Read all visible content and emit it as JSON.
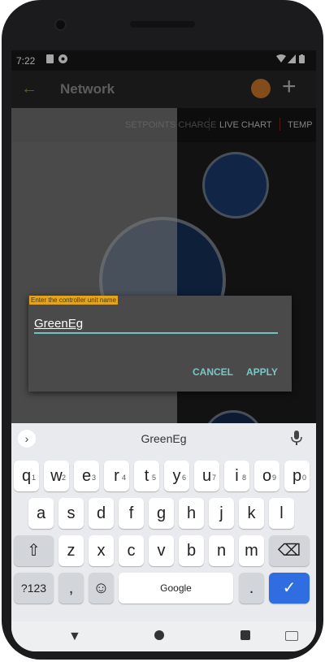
{
  "status_bar": {
    "time": "7:22"
  },
  "app_bar": {
    "title": "Network"
  },
  "tabs": [
    {
      "label": "LIVE CHART"
    },
    {
      "label": "TEMP"
    },
    {
      "label": "SETPOINTS CHARGE"
    }
  ],
  "dialog": {
    "prompt_label": "Enter the controller unit name",
    "input_value": "GreenEg",
    "cancel_label": "CANCEL",
    "apply_label": "APPLY"
  },
  "keyboard": {
    "suggestion": "GreenEg",
    "row1": [
      {
        "key": "q",
        "hint": "1"
      },
      {
        "key": "w",
        "hint": "2"
      },
      {
        "key": "e",
        "hint": "3"
      },
      {
        "key": "r",
        "hint": "4"
      },
      {
        "key": "t",
        "hint": "5"
      },
      {
        "key": "y",
        "hint": "6"
      },
      {
        "key": "u",
        "hint": "7"
      },
      {
        "key": "i",
        "hint": "8"
      },
      {
        "key": "o",
        "hint": "9"
      },
      {
        "key": "p",
        "hint": "0"
      }
    ],
    "row2": [
      "a",
      "s",
      "d",
      "f",
      "g",
      "h",
      "j",
      "k",
      "l"
    ],
    "row3": [
      "z",
      "x",
      "c",
      "v",
      "b",
      "n",
      "m"
    ],
    "sym_label": "?123",
    "comma_label": ",",
    "space_label": "Google",
    "period_label": ".",
    "shift_symbol": "⇧",
    "backspace_symbol": "⌫",
    "emoji_symbol": "☺",
    "enter_symbol": "✓"
  },
  "colors": {
    "accent": "#79c7c7",
    "label_bg": "#e2a31f",
    "enter_key": "#2f6de1"
  }
}
